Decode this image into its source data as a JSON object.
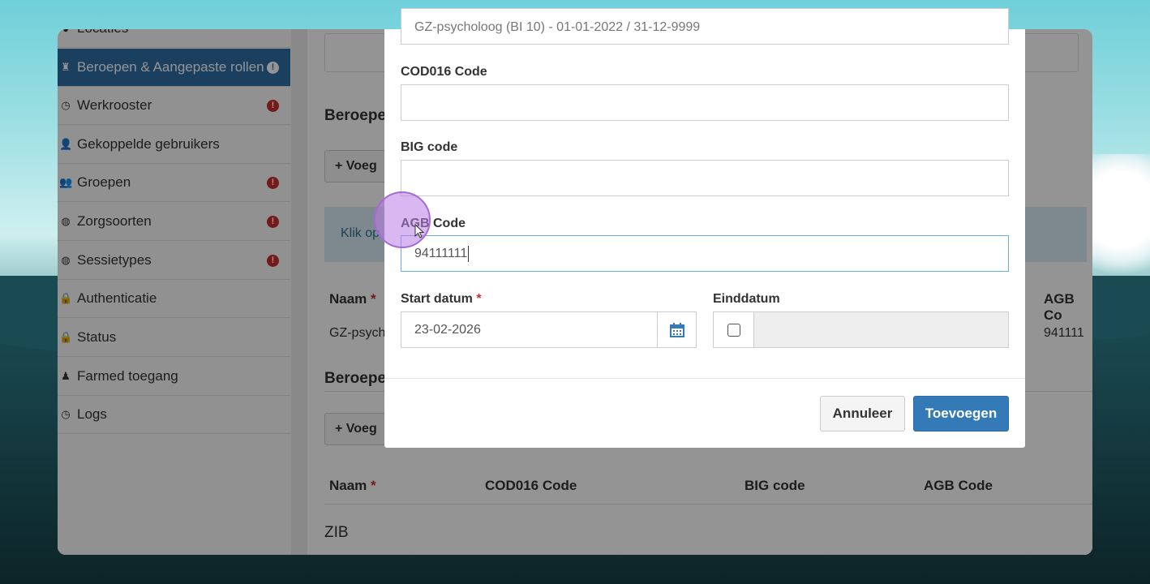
{
  "sidebar": {
    "items": [
      {
        "label": "Locaties",
        "icon": "map-marker-icon",
        "warn": false
      },
      {
        "label": "Beroepen & Aangepaste rollen",
        "icon": "user-md-icon",
        "warn": true
      },
      {
        "label": "Werkrooster",
        "icon": "clock-icon",
        "warn": true
      },
      {
        "label": "Gekoppelde gebruikers",
        "icon": "user-icon",
        "warn": false
      },
      {
        "label": "Groepen",
        "icon": "users-icon",
        "warn": true
      },
      {
        "label": "Zorgsoorten",
        "icon": "globe-icon",
        "warn": true
      },
      {
        "label": "Sessietypes",
        "icon": "globe-icon",
        "warn": true
      },
      {
        "label": "Authenticatie",
        "icon": "lock-icon",
        "warn": false
      },
      {
        "label": "Status",
        "icon": "lock-icon",
        "warn": false
      },
      {
        "label": "Farmed toegang",
        "icon": "user-secret-icon",
        "warn": false
      },
      {
        "label": "Logs",
        "icon": "clock-icon",
        "warn": false
      }
    ],
    "warn_glyph": "!"
  },
  "main": {
    "section1_title": "Beroepe",
    "add_button": "+ Voeg",
    "info_text": "Klik op",
    "table1": {
      "col_name": "Naam",
      "col_agb": "AGB Co",
      "row_name": "GZ-psych",
      "row_agb": "941111"
    },
    "section2_title": "Beroepe",
    "add_button2": "+ Voeg",
    "table2": {
      "col_name": "Naam",
      "col_cod": "COD016 Code",
      "col_big": "BIG code",
      "col_agb": "AGB Code"
    },
    "section3_title": "ZIB",
    "required_mark": "*"
  },
  "modal": {
    "beroep_value": "GZ-psycholoog (BI 10) - 01-01-2022 / 31-12-9999",
    "cod_label": "COD016 Code",
    "cod_value": "",
    "big_label": "BIG code",
    "big_value": "",
    "agb_label": "AGB Code",
    "agb_value": "94111111",
    "start_label": "Start datum",
    "start_value": "23-02-2026",
    "end_label": "Einddatum",
    "end_value": "",
    "cancel_label": "Annuleer",
    "add_label": "Toevoegen",
    "required_mark": "*"
  },
  "colors": {
    "accent": "#337ab7",
    "active_sidebar": "#2e6da4",
    "warning": "#c9302c"
  }
}
